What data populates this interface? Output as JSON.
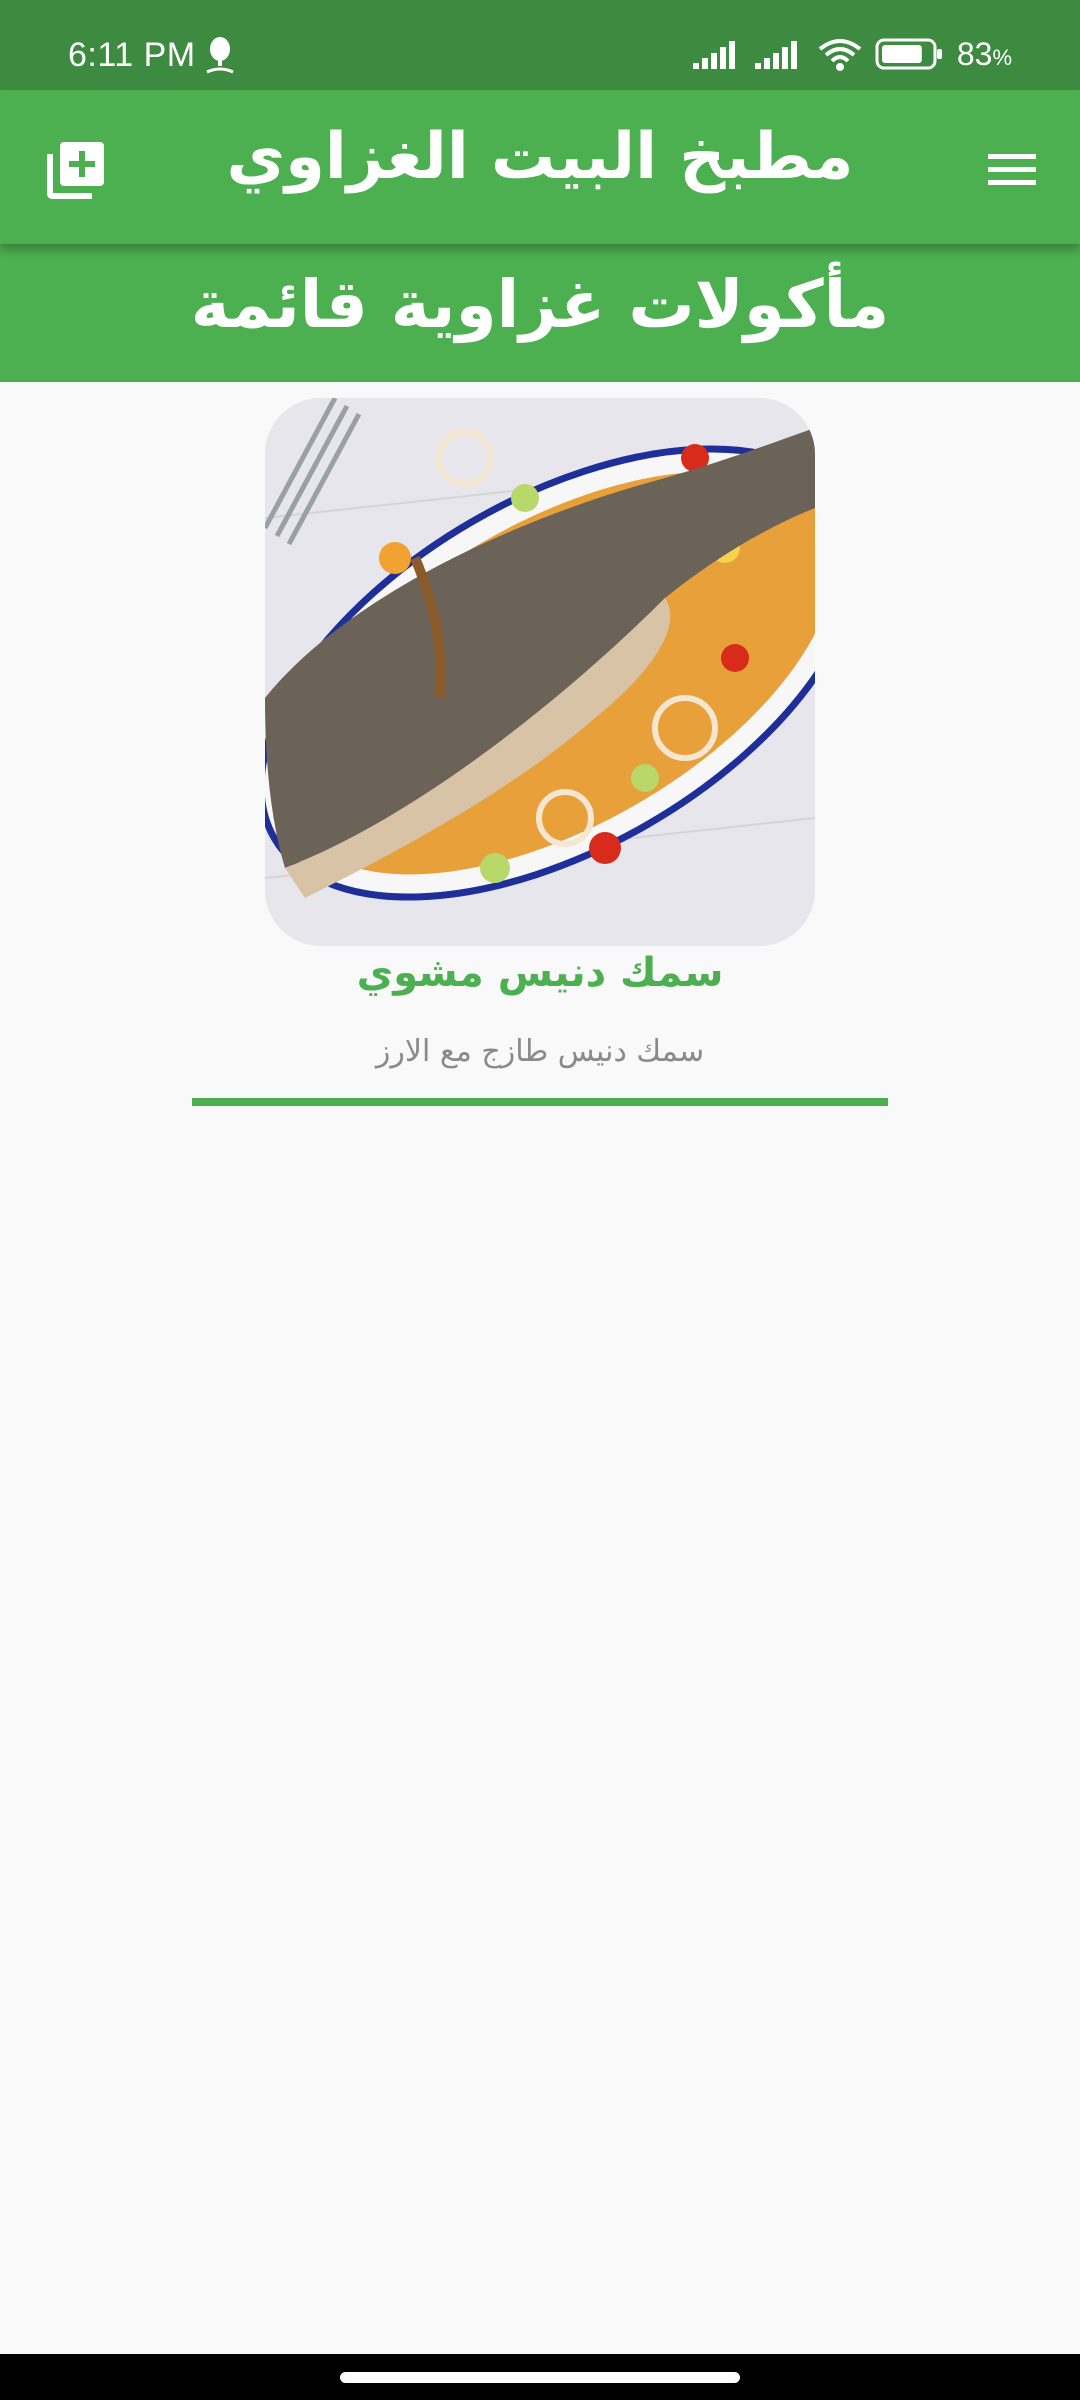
{
  "status_bar": {
    "time": "6:11 PM",
    "battery_percent": "83",
    "battery_unit": "%",
    "battery_level": 0.83,
    "icons": [
      "app-notification-icon",
      "signal-icon",
      "signal-icon",
      "wifi-icon",
      "battery-icon"
    ]
  },
  "app_bar": {
    "title": "مطبخ البيت الغزاوي",
    "left_icon": "add-to-collection-icon",
    "right_icon": "menu-icon"
  },
  "category": {
    "title": "مأكولات غزاوية قائمة"
  },
  "recipes": [
    {
      "name": "سمك دنيس مشوي",
      "description": "سمك دنيس طازج مع الارز",
      "image": "grilled-sea-bream-photo"
    }
  ],
  "colors": {
    "status_bar": "#3d8b40",
    "primary": "#4caf50",
    "background": "#f9f9f9",
    "description_text": "#8a8a8a"
  }
}
